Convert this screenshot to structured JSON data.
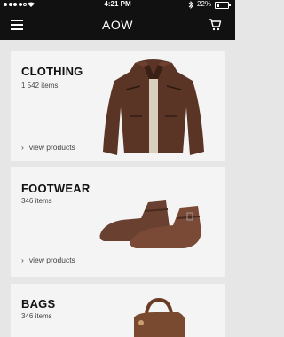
{
  "status_bar": {
    "time": "4:21 PM",
    "battery": "22%",
    "battery_level": 0.22
  },
  "header": {
    "title": "AOW"
  },
  "categories": [
    {
      "title": "CLOTHING",
      "count": "1 542 items",
      "link": "view products"
    },
    {
      "title": "FOOTWEAR",
      "count": "346 items",
      "link": "view products"
    },
    {
      "title": "BAGS",
      "count": "346 items"
    }
  ],
  "icons": {
    "menu": "hamburger-menu-icon",
    "cart": "shopping-cart-icon",
    "wifi": "wifi-icon",
    "bluetooth": "bluetooth-icon",
    "battery": "battery-icon",
    "chevron": "chevron-right-icon"
  }
}
